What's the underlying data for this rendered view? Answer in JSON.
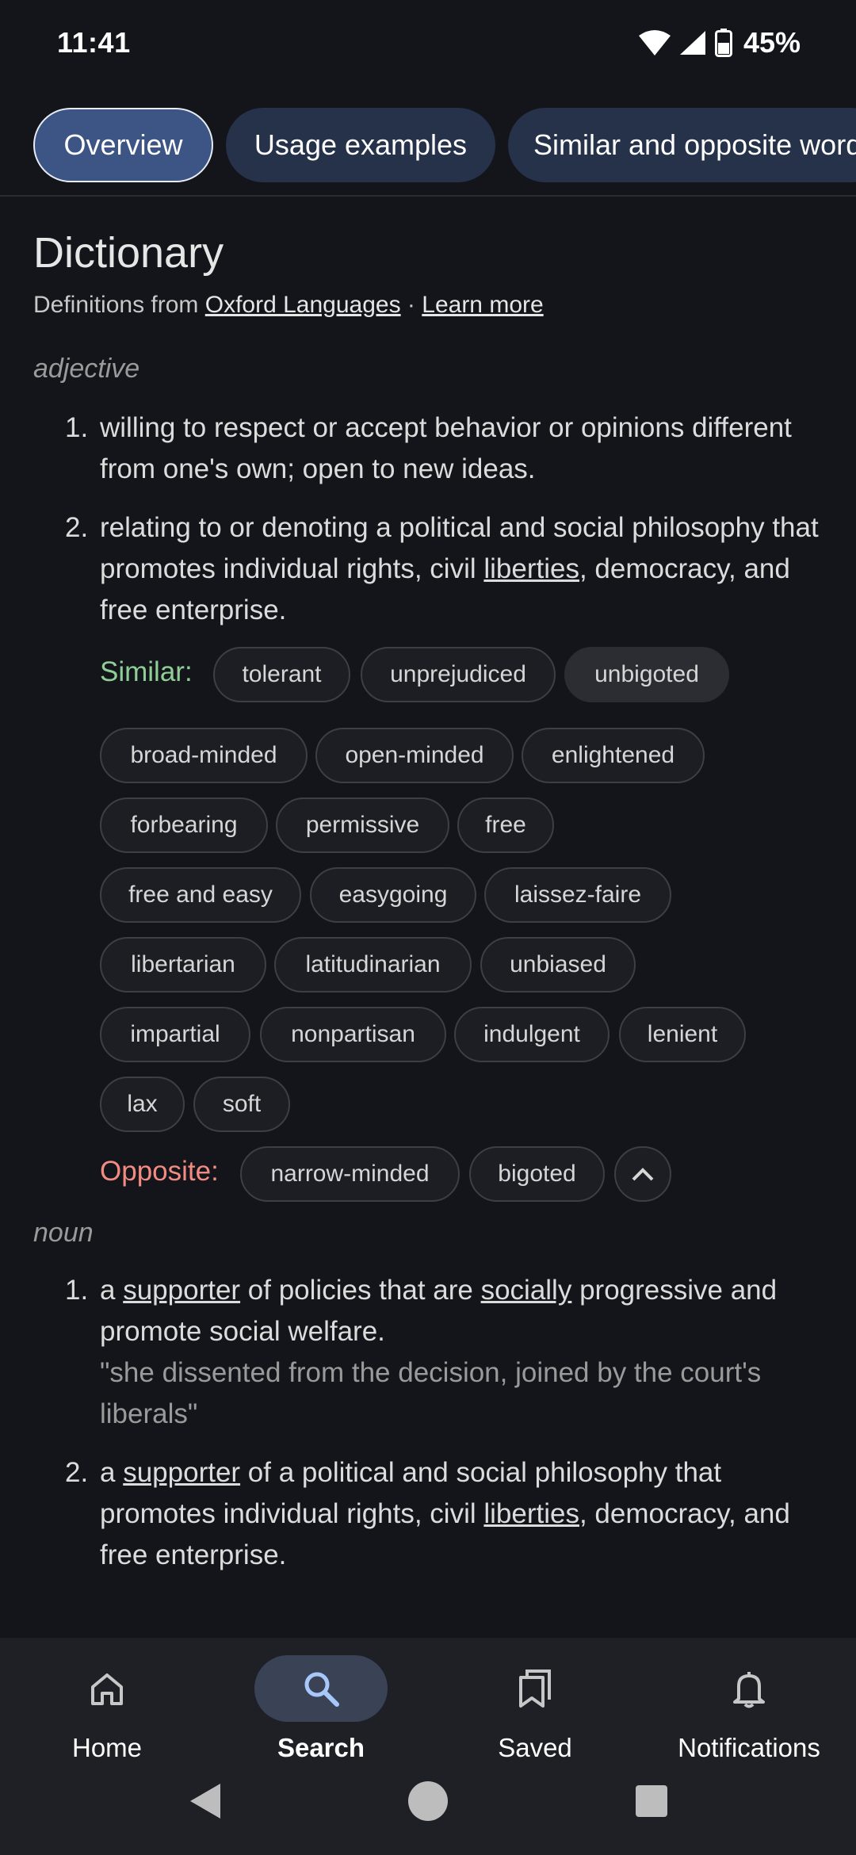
{
  "status_bar": {
    "time": "11:41",
    "battery": "45%"
  },
  "tabs": [
    {
      "label": "Overview"
    },
    {
      "label": "Usage examples"
    },
    {
      "label": "Similar and opposite words"
    }
  ],
  "dictionary": {
    "title": "Dictionary",
    "source_prefix": "Definitions from ",
    "source_link": "Oxford Languages",
    "separator": " · ",
    "learn_more": "Learn more",
    "adjective": {
      "pos": "adjective",
      "definitions": [
        {
          "num": "1.",
          "text": "willing to respect or accept behavior or opinions different from one's own; open to new ideas."
        },
        {
          "num": "2.",
          "text_a": "relating to or denoting a political and social philosophy that promotes individual rights, civil ",
          "link": "liberties",
          "text_b": ", democracy, and free enterprise."
        }
      ],
      "similar_label": "Similar:",
      "similar": [
        "tolerant",
        "unprejudiced",
        "unbigoted",
        "broad-minded",
        "open-minded",
        "enlightened",
        "forbearing",
        "permissive",
        "free",
        "free and easy",
        "easygoing",
        "laissez-faire",
        "libertarian",
        "latitudinarian",
        "unbiased",
        "impartial",
        "nonpartisan",
        "indulgent",
        "lenient",
        "lax",
        "soft"
      ],
      "opposite_label": "Opposite:",
      "opposite": [
        "narrow-minded",
        "bigoted"
      ]
    },
    "noun": {
      "pos": "noun",
      "definitions": [
        {
          "num": "1.",
          "a": "a ",
          "link1": "supporter",
          "b": " of policies that are ",
          "link2": "socially",
          "c": " progressive and promote social welfare.",
          "example": "\"she dissented from the decision, joined by the court's liberals\""
        },
        {
          "num": "2.",
          "a": "a ",
          "link1": "supporter",
          "b": " of a political and social philosophy that promotes individual rights, civil ",
          "link2": "liberties",
          "c": ", democracy, and free enterprise."
        }
      ]
    }
  },
  "bottom_nav": [
    {
      "label": "Home",
      "icon": "home-icon"
    },
    {
      "label": "Search",
      "icon": "search-icon"
    },
    {
      "label": "Saved",
      "icon": "saved-icon"
    },
    {
      "label": "Notifications",
      "icon": "bell-icon"
    }
  ]
}
